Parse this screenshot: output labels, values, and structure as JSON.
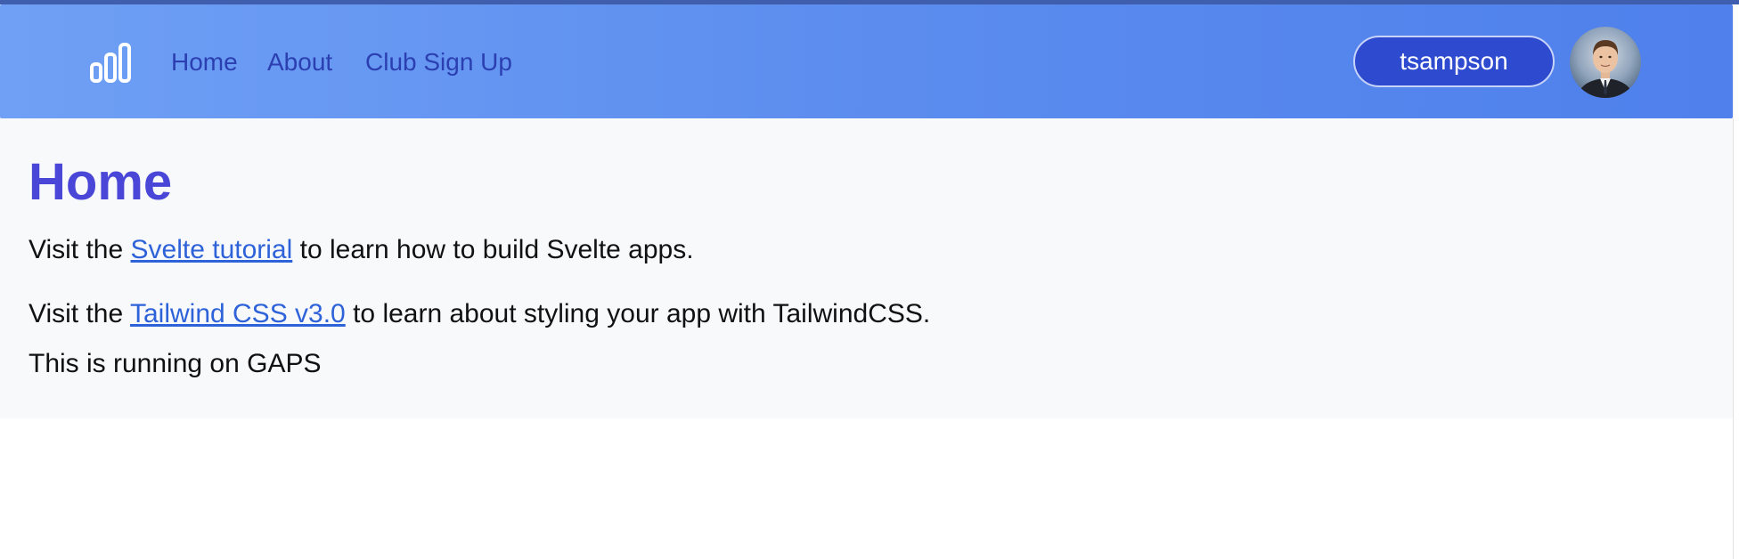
{
  "nav": {
    "logo_icon": "bar-chart-icon",
    "links": [
      {
        "label": "Home"
      },
      {
        "label": "About"
      },
      {
        "label": "Club Sign Up"
      }
    ],
    "user_button_label": "tsampson",
    "avatar": "user-avatar-photo"
  },
  "main": {
    "title": "Home",
    "para1": {
      "before": "Visit the ",
      "link": "Svelte tutorial",
      "after": " to learn how to build Svelte apps."
    },
    "para2": {
      "before": "Visit the ",
      "link": "Tailwind CSS v3.0",
      "after": " to learn about styling your app with TailwindCSS."
    },
    "para3": "This is running on GAPS"
  },
  "colors": {
    "nav_gradient_start": "#6fa0f5",
    "nav_gradient_end": "#4f80ec",
    "nav_link": "#2b3fb0",
    "user_button": "#2e4bd0",
    "title": "#4a47d8",
    "link": "#2e62d9"
  }
}
